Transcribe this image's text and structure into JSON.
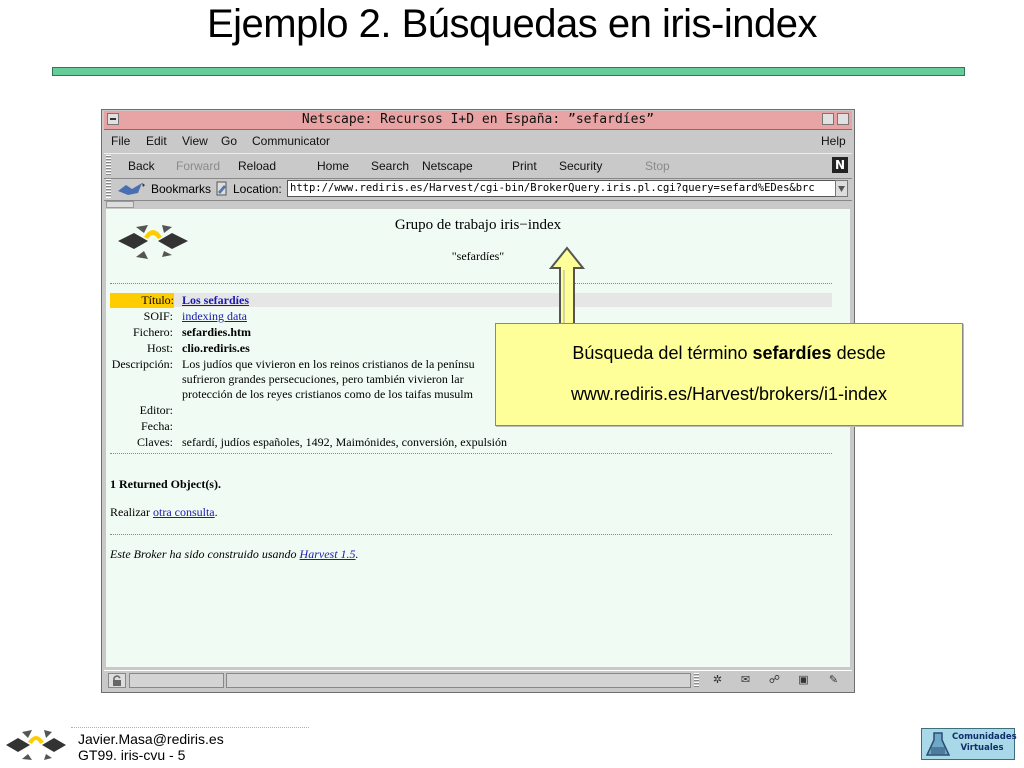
{
  "slide": {
    "title": "Ejemplo 2. Búsquedas en iris-index",
    "footer_email": "Javier.Masa@rediris.es",
    "footer_id": "GT99. iris-cvu - 5",
    "footer_logo_text": "Comunidades Virtuales"
  },
  "browser": {
    "window_title": "Netscape: Recursos I+D en España: ”sefardíes”",
    "menu": [
      "File",
      "Edit",
      "View",
      "Go",
      "Communicator",
      "Help"
    ],
    "toolbar": [
      "Back",
      "Forward",
      "Reload",
      "Home",
      "Search",
      "Netscape",
      "Print",
      "Security",
      "Stop"
    ],
    "bookmarks_label": "Bookmarks",
    "location_label": "Location:",
    "url": "http://www.rediris.es/Harvest/cgi-bin/BrokerQuery.iris.pl.cgi?query=sefard%EDes&brc",
    "logo_letter": "N"
  },
  "page": {
    "group_title": "Grupo de trabajo iris−index",
    "query": "\"sefardíes\"",
    "result": {
      "titulo_label": "Título:",
      "titulo_value": "Los sefardíes",
      "soif_label": "SOIF:",
      "soif_value": "indexing data",
      "fichero_label": "Fichero:",
      "fichero_value": "sefardies.htm",
      "host_label": "Host:",
      "host_value": "clio.rediris.es",
      "descripcion_label": "Descripción:",
      "descripcion_lines": [
        "Los judíos que vivieron en los reinos cristianos de la penínsu",
        "sufrieron grandes persecuciones, pero también vivieron lar",
        "protección de los reyes cristianos como de los taifas musulm"
      ],
      "editor_label": "Editor:",
      "fecha_label": "Fecha:",
      "claves_label": "Claves:",
      "claves_value": "sefardí, judíos españoles, 1492, Maimónides, conversión, expulsión"
    },
    "returned": "1 Returned Object(s).",
    "realizar_prefix": "Realizar",
    "realizar_link": "otra consulta",
    "realizar_suffix": ".",
    "broker_prefix": "Este Broker ha sido construido usando",
    "broker_link": "Harvest 1.5",
    "broker_suffix": "."
  },
  "callout": {
    "line1_prefix": "Búsqueda del término",
    "line1_bold": "sefardíes",
    "line1_suffix": "desde",
    "line2": "www.rediris.es/Harvest/brokers/i1-index"
  },
  "colors": {
    "title_rule": "#66cc99",
    "callout_bg": "#ffff99",
    "titlebar": "#e8a4a4",
    "page_bg": "#f0fbf3",
    "highlight": "#ffcc00"
  }
}
